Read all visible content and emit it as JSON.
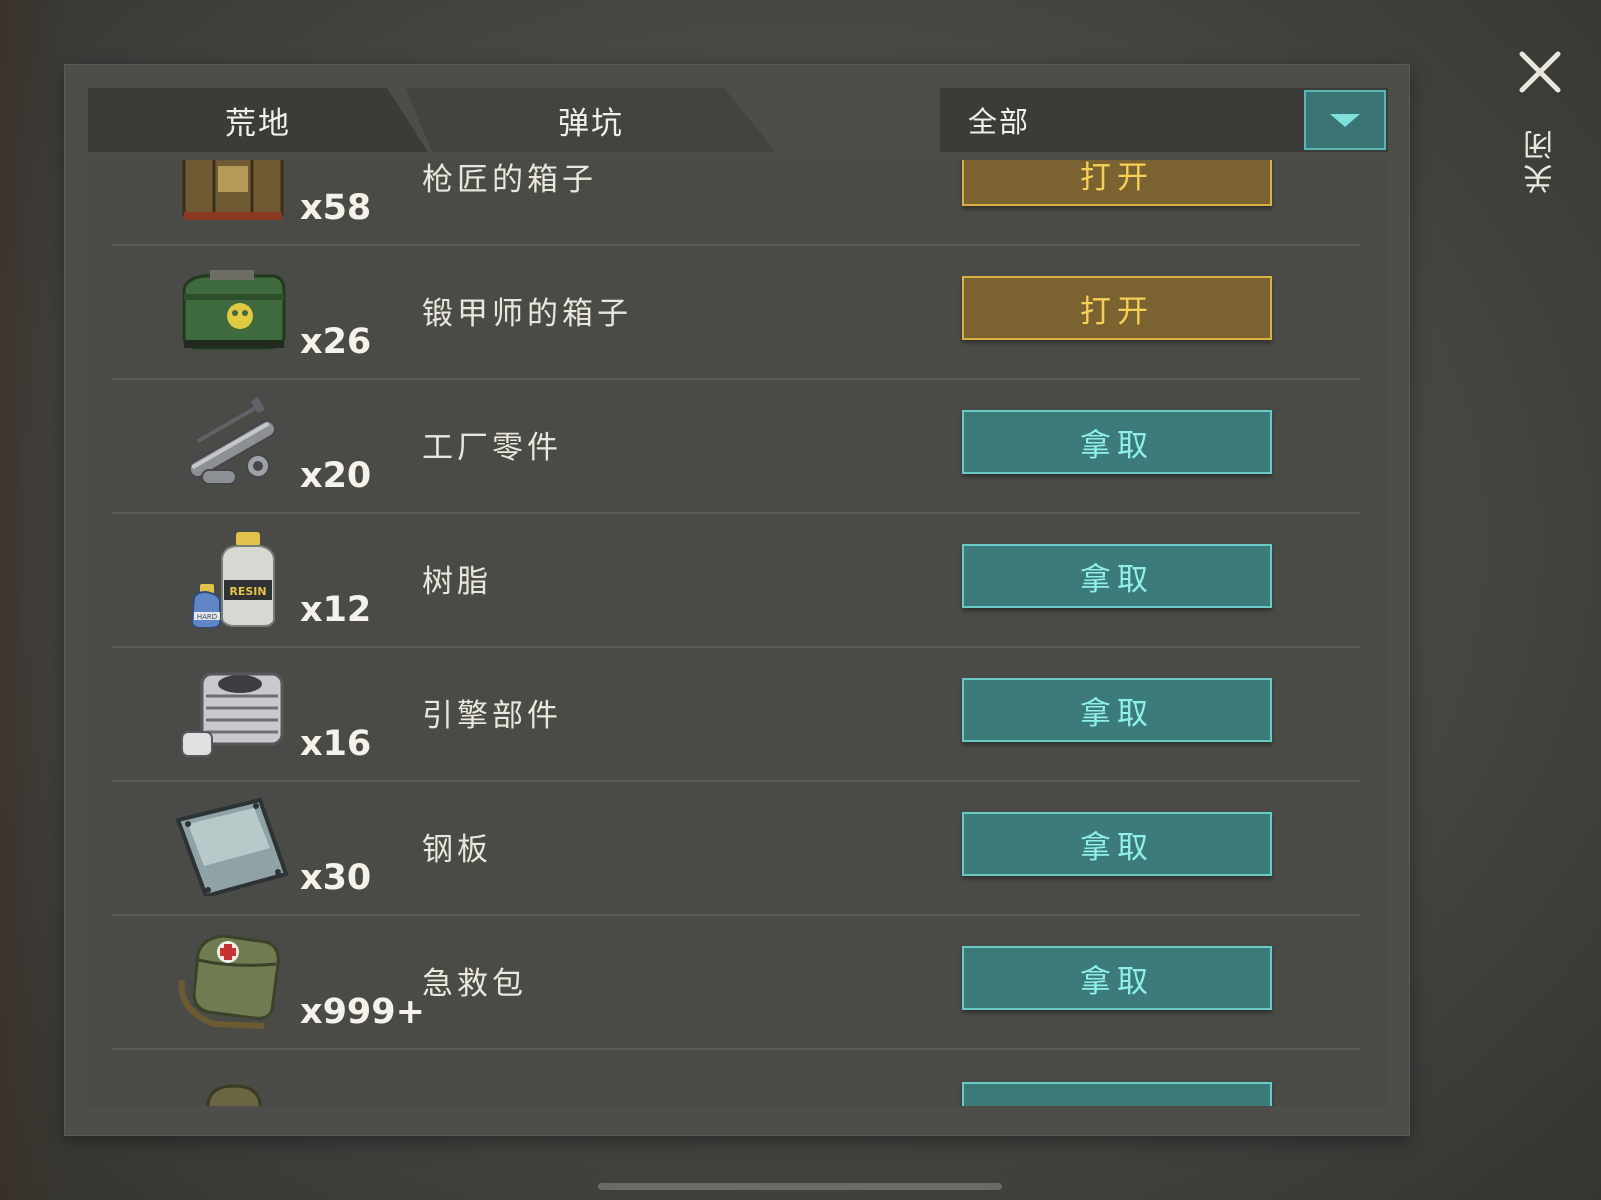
{
  "tabs": [
    {
      "label": "荒地"
    },
    {
      "label": "弹坑"
    }
  ],
  "filter": {
    "selected": "全部"
  },
  "close": {
    "label": "关闭"
  },
  "items": [
    {
      "name": "枪匠的箱子",
      "qty": "x58",
      "action": "打开",
      "icon": "wooden-crate-icon"
    },
    {
      "name": "锻甲师的箱子",
      "qty": "x26",
      "action": "打开",
      "icon": "green-armor-box-icon"
    },
    {
      "name": "工厂零件",
      "qty": "x20",
      "action": "拿取",
      "icon": "factory-parts-icon"
    },
    {
      "name": "树脂",
      "qty": "x12",
      "action": "拿取",
      "icon": "resin-bottles-icon",
      "resin_label": "RESIN",
      "hard_label": "HARD"
    },
    {
      "name": "引擎部件",
      "qty": "x16",
      "action": "拿取",
      "icon": "engine-part-icon"
    },
    {
      "name": "钢板",
      "qty": "x30",
      "action": "拿取",
      "icon": "steel-plate-icon"
    },
    {
      "name": "急救包",
      "qty": "x999+",
      "action": "拿取",
      "icon": "first-aid-bag-icon"
    }
  ],
  "colors": {
    "open_button": "#7a6330",
    "take_button": "#3d7a7a",
    "panel": "#4d4e49"
  }
}
